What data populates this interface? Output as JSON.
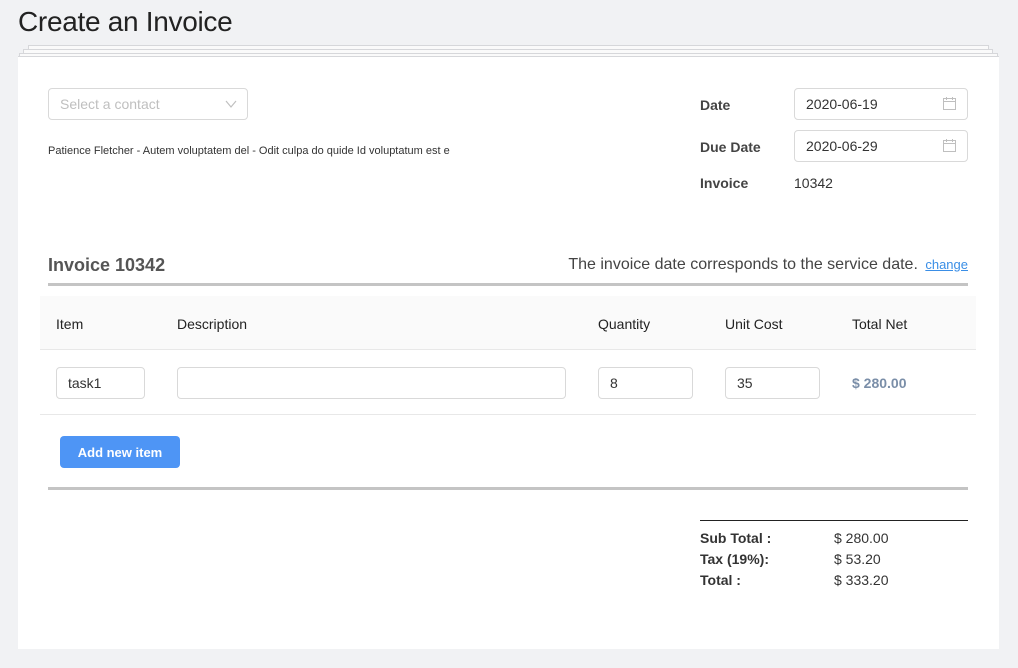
{
  "page": {
    "title": "Create an Invoice"
  },
  "contact": {
    "placeholder": "Select a contact",
    "details": "Patience Fletcher - Autem voluptatem del - Odit culpa do quide Id voluptatum est e"
  },
  "meta": {
    "date_label": "Date",
    "date_value": "2020-06-19",
    "due_label": "Due Date",
    "due_value": "2020-06-29",
    "invoice_label": "Invoice",
    "invoice_value": "10342"
  },
  "invoice": {
    "title": "Invoice 10342",
    "note": "The invoice date corresponds to the service date.",
    "change_link": "change"
  },
  "table": {
    "headers": [
      "Item",
      "Description",
      "Quantity",
      "Unit Cost",
      "Total Net"
    ],
    "rows": [
      {
        "item": "task1",
        "description": "",
        "quantity": "8",
        "unit_cost": "35",
        "total_net": "$ 280.00"
      }
    ],
    "add_button": "Add new item"
  },
  "totals": {
    "subtotal_label": "Sub Total :",
    "subtotal_value": "$ 280.00",
    "tax_label": "Tax (19%):",
    "tax_value": "$ 53.20",
    "total_label": "Total :",
    "total_value": "$ 333.20"
  },
  "colors": {
    "accent": "#4e95f5",
    "link": "#3a8ee6",
    "total_net": "#7a8ea8"
  },
  "icons": {
    "select": "chevron-down-icon",
    "date": "calendar-icon"
  }
}
